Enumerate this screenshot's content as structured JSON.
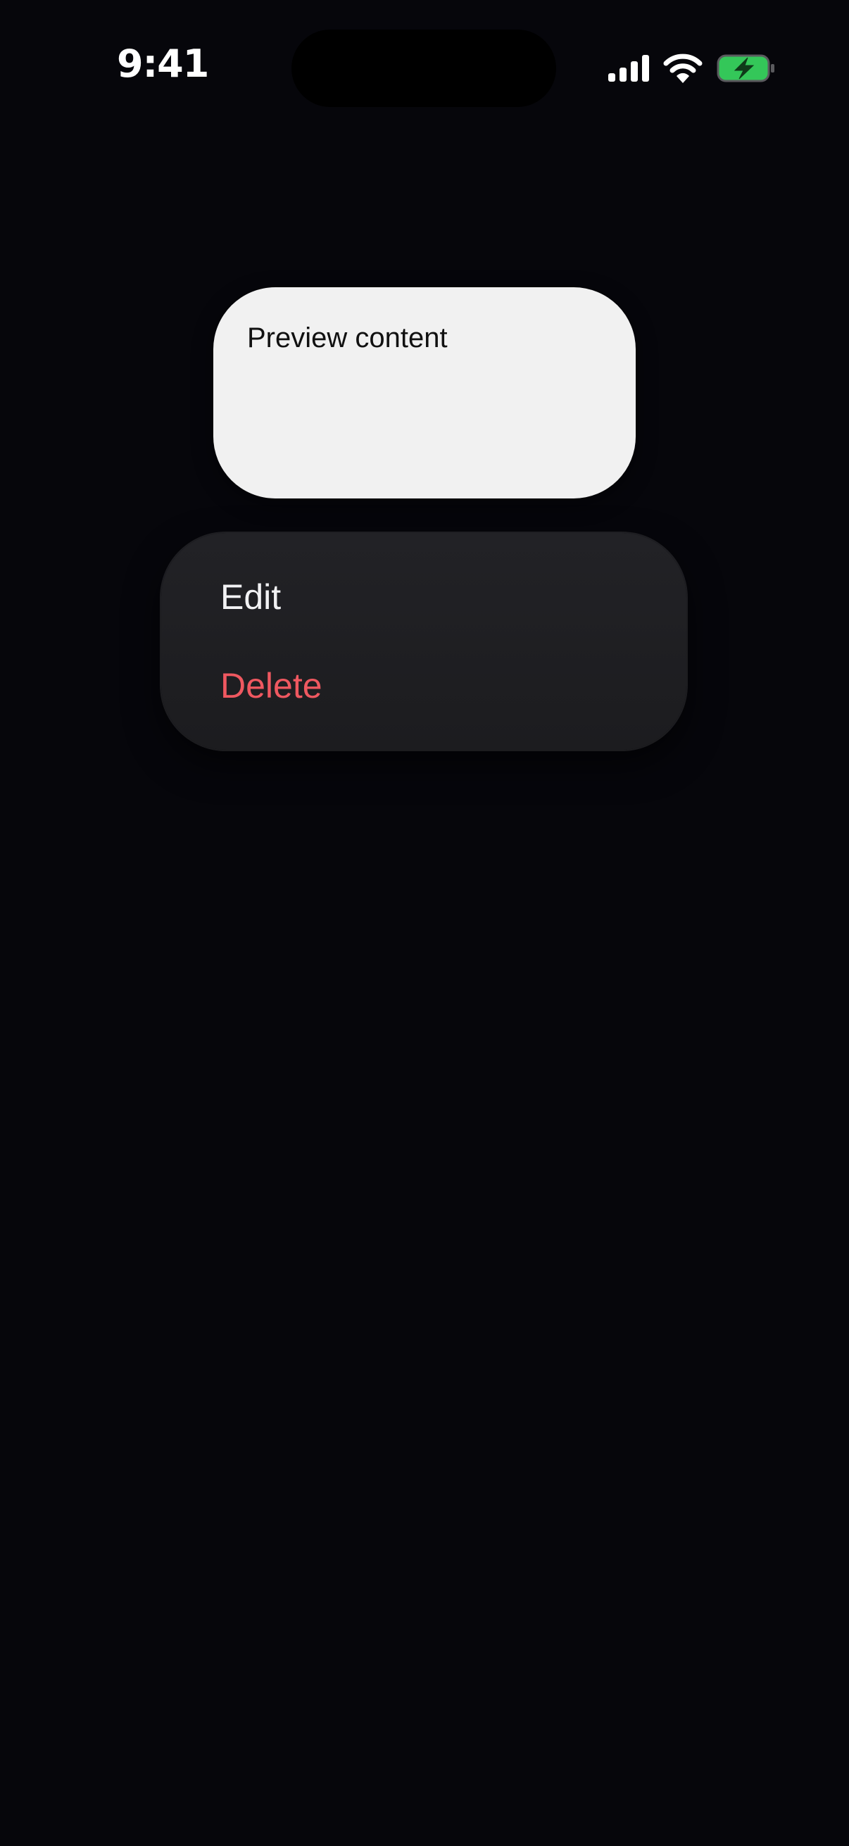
{
  "status_bar": {
    "time": "9:41",
    "icons": [
      "cellular-signal-icon",
      "wifi-icon",
      "battery-charging-icon"
    ],
    "battery_color": "#34c759"
  },
  "preview": {
    "text": "Preview content"
  },
  "context_menu": {
    "items": [
      {
        "label": "Edit",
        "color": "#f2f2f4"
      },
      {
        "label": "Delete",
        "color": "#ef5860"
      }
    ]
  }
}
